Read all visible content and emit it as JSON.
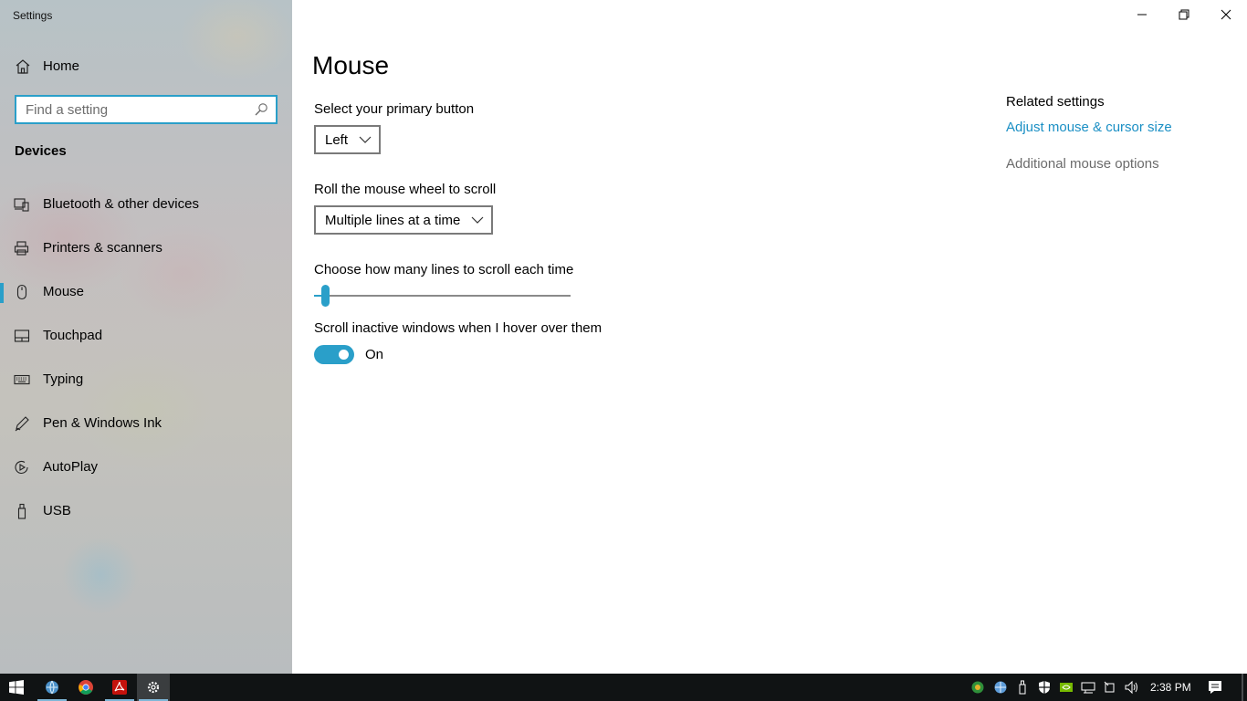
{
  "window": {
    "title": "Settings"
  },
  "sidebar": {
    "home_label": "Home",
    "search_placeholder": "Find a setting",
    "section_title": "Devices",
    "items": [
      {
        "label": "Bluetooth & other devices",
        "icon": "bluetooth-devices-icon"
      },
      {
        "label": "Printers & scanners",
        "icon": "printer-icon"
      },
      {
        "label": "Mouse",
        "icon": "mouse-icon",
        "selected": true
      },
      {
        "label": "Touchpad",
        "icon": "touchpad-icon"
      },
      {
        "label": "Typing",
        "icon": "keyboard-icon"
      },
      {
        "label": "Pen & Windows Ink",
        "icon": "pen-icon"
      },
      {
        "label": "AutoPlay",
        "icon": "autoplay-icon"
      },
      {
        "label": "USB",
        "icon": "usb-icon"
      }
    ]
  },
  "main": {
    "title": "Mouse",
    "primary_button": {
      "label": "Select your primary button",
      "value": "Left"
    },
    "wheel_scroll": {
      "label": "Roll the mouse wheel to scroll",
      "value": "Multiple lines at a time"
    },
    "lines_to_scroll": {
      "label": "Choose how many lines to scroll each time",
      "slider_fraction": 0.03
    },
    "scroll_inactive": {
      "label": "Scroll inactive windows when I hover over them",
      "state": "On"
    },
    "related": {
      "title": "Related settings",
      "link1": "Adjust mouse & cursor size",
      "link2": "Additional mouse options"
    }
  },
  "taskbar": {
    "clock": "2:38 PM"
  },
  "colors": {
    "accent": "#2a9fc9",
    "link": "#1a8fc4"
  }
}
